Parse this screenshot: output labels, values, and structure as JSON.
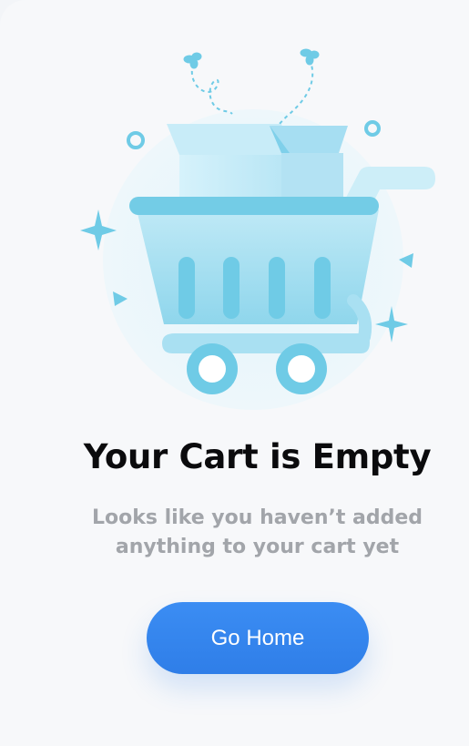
{
  "empty_state": {
    "title": "Your Cart is Empty",
    "subtitle_line1": "Looks like you haven’t added",
    "subtitle_line2": "anything to your cart yet",
    "button_label": "Go Home"
  },
  "illustration": {
    "icon": "shopping-cart-icon"
  },
  "colors": {
    "accent": "#2f7ee8",
    "title": "#0b0b0d",
    "subtitle": "#a2a5aa",
    "illustration_primary": "#6fcbe6",
    "illustration_light": "#cdeef8"
  }
}
